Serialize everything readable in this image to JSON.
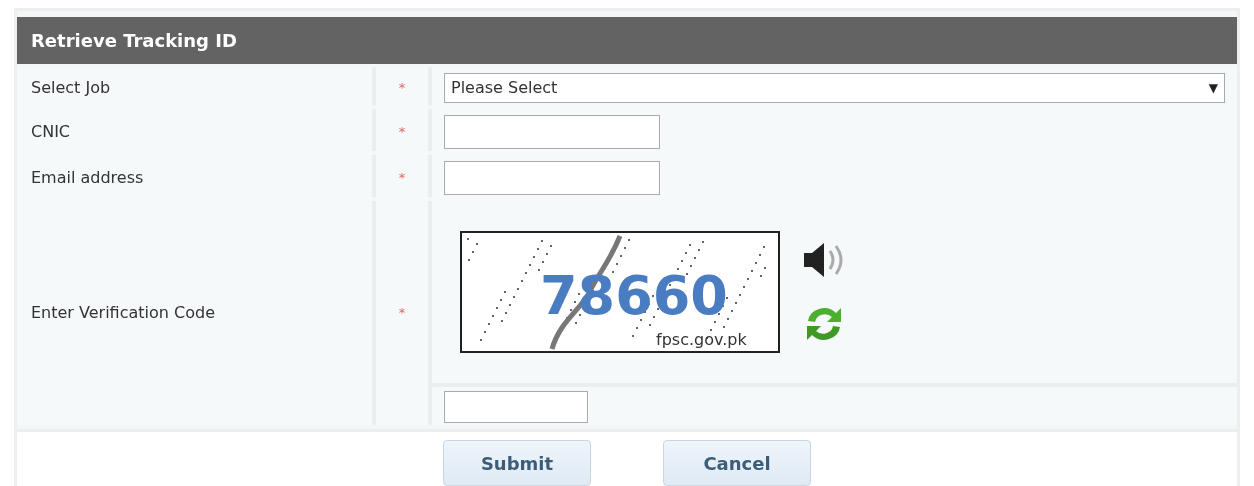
{
  "panel": {
    "title": "Retrieve Tracking ID"
  },
  "fields": [
    {
      "kind": "select",
      "label": "Select Job",
      "required_mark": "*",
      "value": "Please Select",
      "caret": "▼"
    },
    {
      "kind": "text",
      "label": "CNIC",
      "required_mark": "*"
    },
    {
      "kind": "text",
      "label": "Email address",
      "required_mark": "*"
    },
    {
      "kind": "captcha",
      "label": "Enter Verification Code",
      "required_mark": "*",
      "code": "78660",
      "site": "fpsc.gov.pk"
    }
  ],
  "buttons": [
    "Submit",
    "Cancel"
  ]
}
